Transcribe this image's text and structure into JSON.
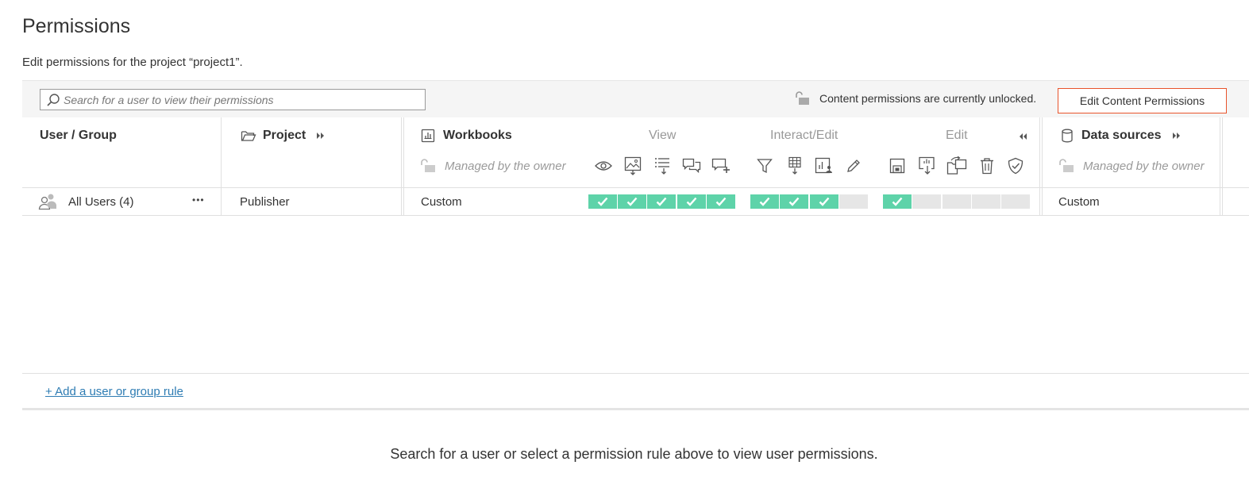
{
  "page": {
    "title": "Permissions",
    "subtitle": "Edit permissions for the project “project1”."
  },
  "toolbar": {
    "search_placeholder": "Search for a user to view their permissions",
    "lock_status": "Content permissions are currently unlocked.",
    "edit_button": "Edit Content Permissions"
  },
  "columns": {
    "user_group": "User / Group",
    "project": "Project",
    "workbooks": "Workbooks",
    "workbooks_groups": [
      "View",
      "Interact/Edit",
      "Edit"
    ],
    "workbooks_managed": "Managed by the owner",
    "workbooks_capability_icons": {
      "view": [
        "eye-icon",
        "image-download-icon",
        "list-download-icon",
        "comments-icon",
        "add-comment-icon"
      ],
      "interact_edit": [
        "filter-icon",
        "data-download-icon",
        "chart-summary-icon",
        "pencil-icon"
      ],
      "edit": [
        "save-icon",
        "download-workbook-icon",
        "move-icon",
        "trash-icon",
        "shield-check-icon"
      ]
    },
    "data_sources": "Data sources",
    "data_sources_managed": "Managed by the owner"
  },
  "rows": [
    {
      "user": "All Users (4)",
      "more": "•••",
      "project": "Publisher",
      "workbooks": "Custom",
      "capabilities": {
        "view": [
          true,
          true,
          true,
          true,
          true
        ],
        "interact_edit": [
          true,
          true,
          true,
          false
        ],
        "edit": [
          true,
          false,
          false,
          false,
          false
        ]
      },
      "data_sources": "Custom"
    }
  ],
  "footer": {
    "add_rule": "+ Add a user or group rule",
    "empty_message": "Search for a user or select a permission rule above to view user permissions."
  },
  "colors": {
    "allowed": "#5ed3a9",
    "unspecified": "#e6e6e6",
    "accent_border": "#e8542c",
    "link": "#2e7cb3"
  }
}
